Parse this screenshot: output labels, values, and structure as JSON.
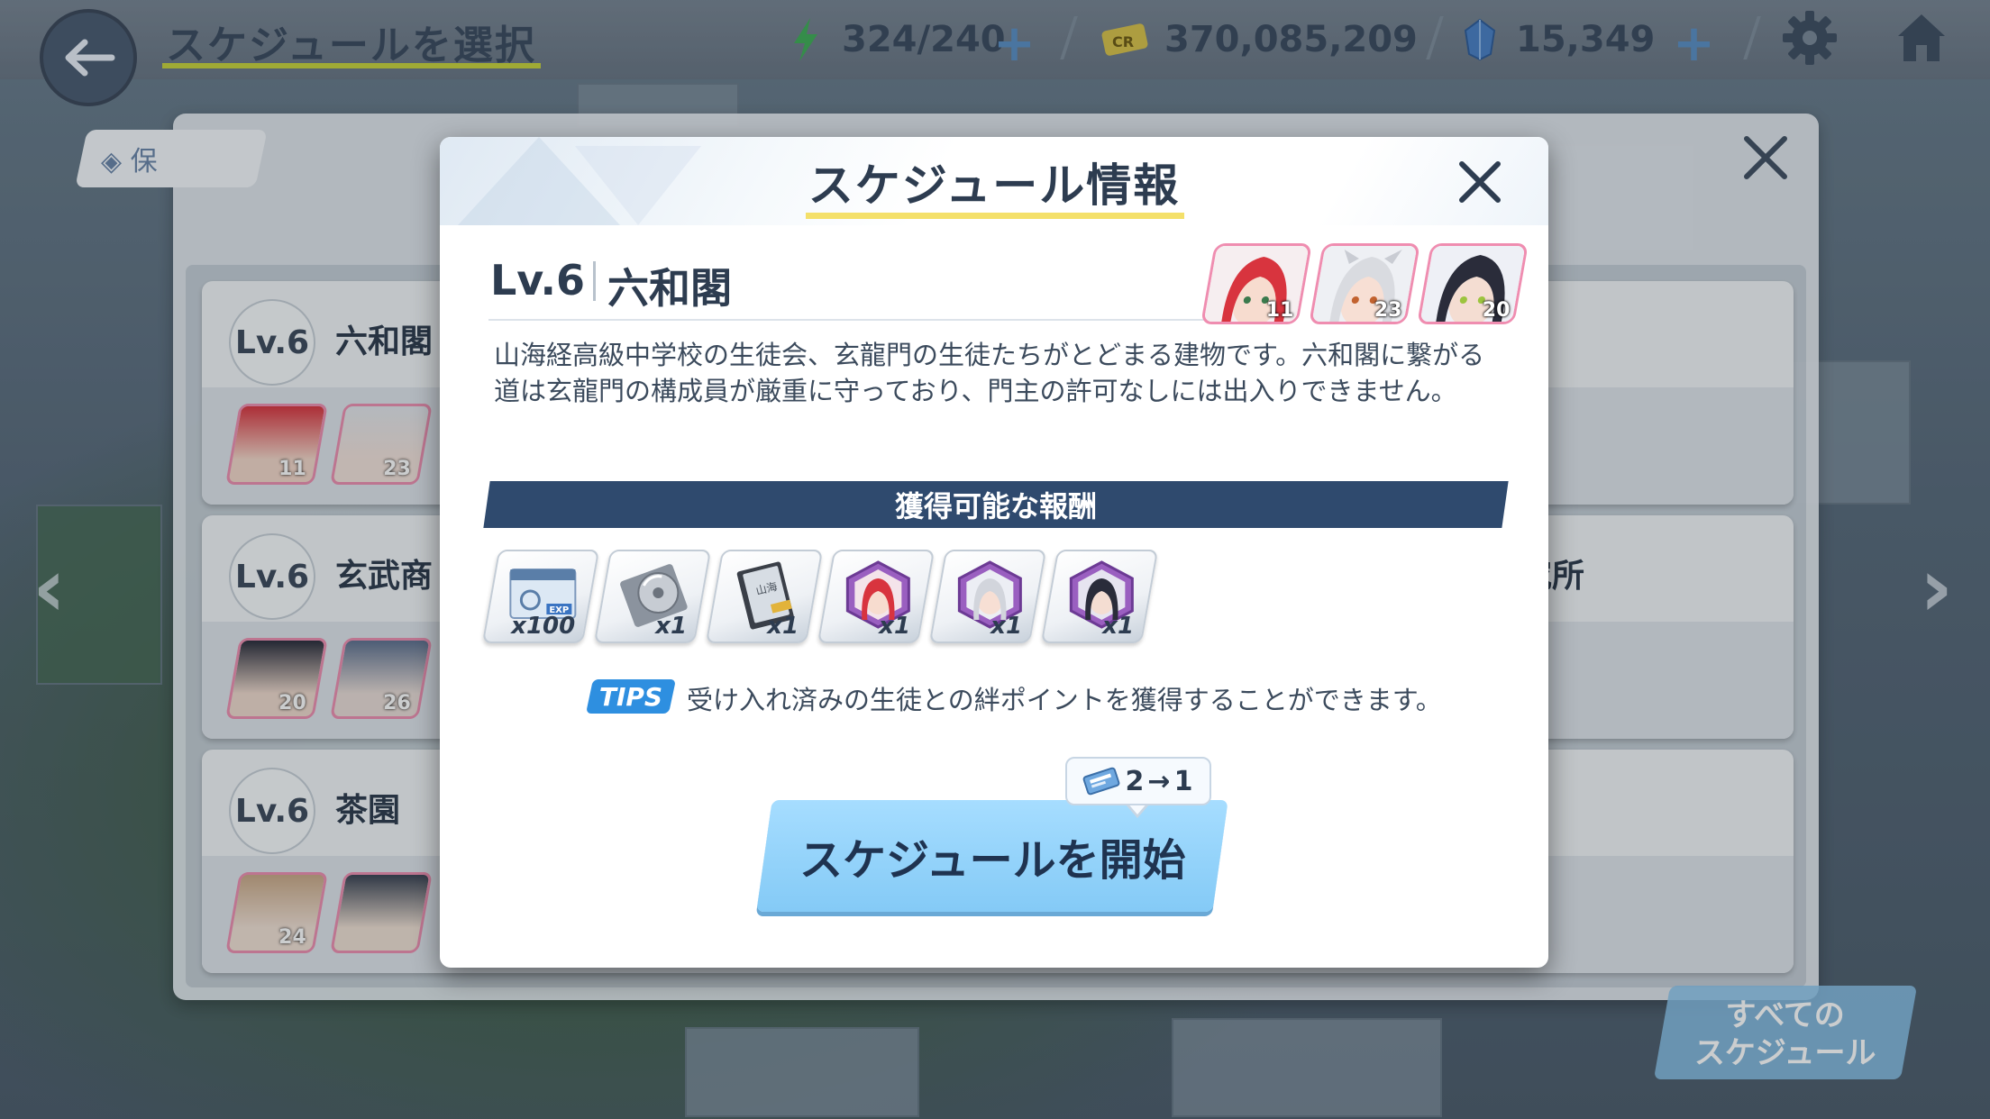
{
  "topbar": {
    "title": "スケジュールを選択",
    "ap": "324/240",
    "credits": "370,085,209",
    "gems": "15,349"
  },
  "list": {
    "save_label": "保",
    "cards": [
      {
        "level": "Lv.6",
        "name": "六和閣",
        "bonds": [
          "11",
          "23"
        ]
      },
      {
        "level": "Lv.6",
        "name": "玄武商",
        "bonds": [
          "20",
          "26"
        ]
      },
      {
        "level": "Lv.6",
        "name": "茶園",
        "bonds": [
          "24",
          ""
        ]
      }
    ],
    "right_card_name": "究所",
    "all_schedules": "すべての\nスケジュール"
  },
  "modal": {
    "title": "スケジュール情報",
    "level": "Lv.6",
    "location": "六和閣",
    "students": [
      {
        "bond": "11",
        "hair": "#d8343e"
      },
      {
        "bond": "23",
        "hair": "#d9dbe0"
      },
      {
        "bond": "20",
        "hair": "#2a2c3a"
      }
    ],
    "description": "山海経高級中学校の生徒会、玄龍門の生徒たちがとどまる建物です。六和閣に繋がる道は玄龍門の構成員が厳重に守っており、門主の許可なしには出入りできません。",
    "reward_header": "獲得可能な報酬",
    "rewards": [
      {
        "icon": "exp-report-icon",
        "count": "x100"
      },
      {
        "icon": "disc-item-icon",
        "count": "x1"
      },
      {
        "icon": "book-item-icon",
        "count": "x1"
      },
      {
        "icon": "student-eleph-red-icon",
        "count": "x1"
      },
      {
        "icon": "student-eleph-white-icon",
        "count": "x1"
      },
      {
        "icon": "student-eleph-black-icon",
        "count": "x1"
      }
    ],
    "tips_label": "TIPS",
    "tips_text": "受け入れ済みの生徒との絆ポイントを獲得することができます。",
    "cost_from": "2",
    "cost_arrow": "→",
    "cost_to": "1",
    "start_label": "スケジュールを開始"
  },
  "colors": {
    "reward_header_bg": "#2f4a6e",
    "start_button": "#8fd0f8",
    "tips_badge": "#2e8fe0",
    "title_underline": "#f4e06a"
  }
}
